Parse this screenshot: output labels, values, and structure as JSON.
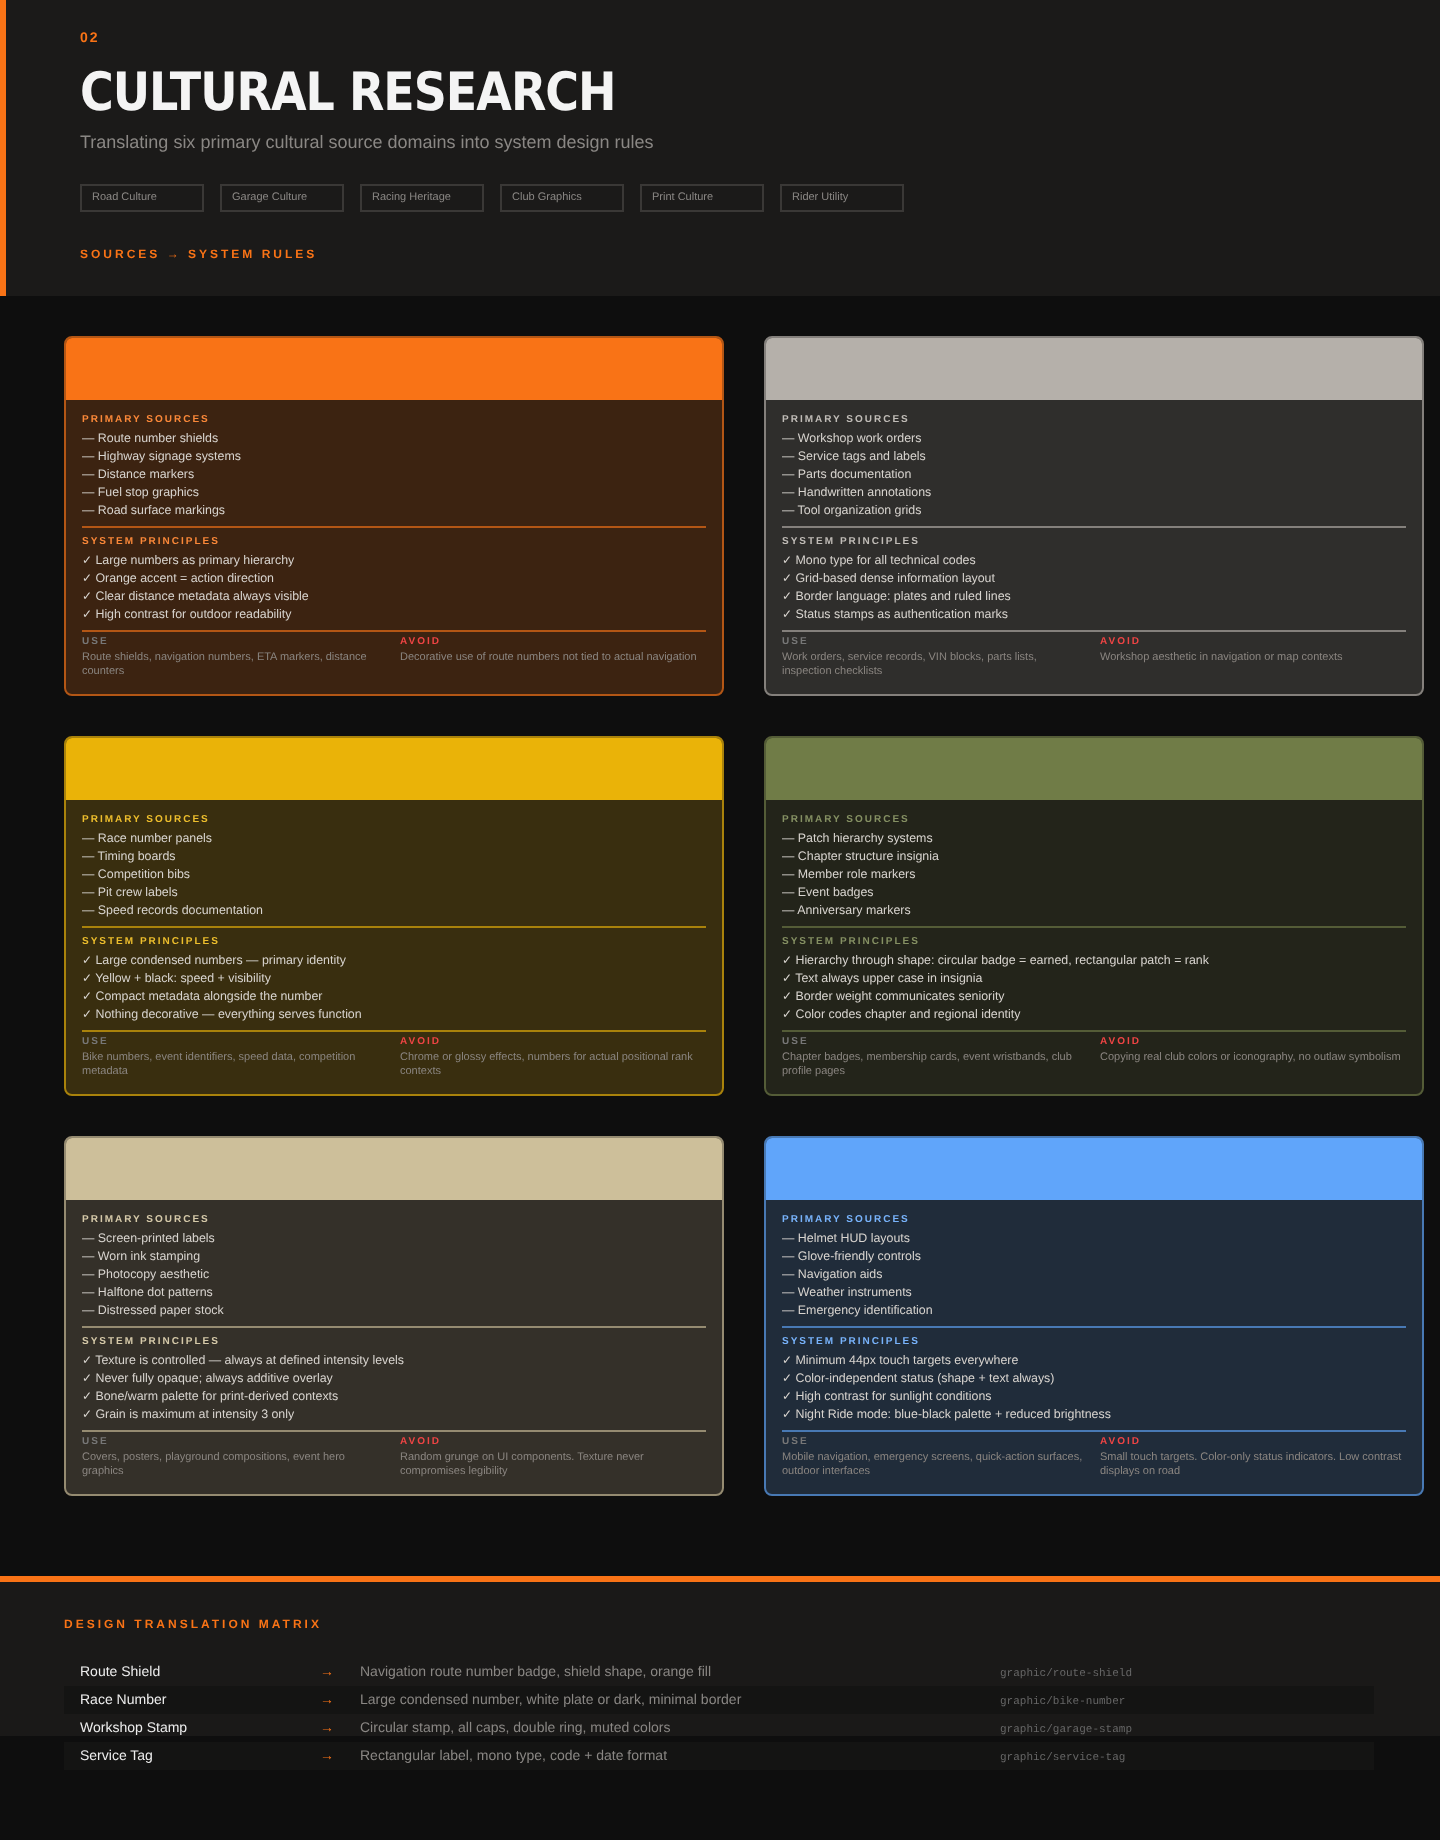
{
  "header": {
    "section_number": "02",
    "title": "CULTURAL RESEARCH",
    "subtitle": "Translating six primary cultural source domains into system design rules",
    "domains": [
      "Road Culture",
      "Garage Culture",
      "Racing Heritage",
      "Club Graphics",
      "Print Culture",
      "Rider Utility"
    ],
    "section_label": "SOURCES → SYSTEM RULES"
  },
  "cards": [
    {
      "color": "#f97316",
      "sources_label": "PRIMARY SOURCES",
      "sources": [
        "— Route number shields",
        "— Highway signage systems",
        "— Distance markers",
        "— Fuel stop graphics",
        "— Road surface markings"
      ],
      "principles_label": "SYSTEM PRINCIPLES",
      "principles": [
        "✓ Large numbers as primary hierarchy",
        "✓ Orange accent = action direction",
        "✓ Clear distance metadata always visible",
        "✓ High contrast for outdoor readability"
      ],
      "use_label": "USE",
      "use": "Route shields, navigation numbers, ETA markers, distance counters",
      "avoid_label": "AVOID",
      "avoid": "Decorative use of route numbers not tied to actual navigation"
    },
    {
      "color": "#b5b0aa",
      "sources_label": "PRIMARY SOURCES",
      "sources": [
        "— Workshop work orders",
        "— Service tags and labels",
        "— Parts documentation",
        "— Handwritten annotations",
        "— Tool organization grids"
      ],
      "principles_label": "SYSTEM PRINCIPLES",
      "principles": [
        "✓ Mono type for all technical codes",
        "✓ Grid-based dense information layout",
        "✓ Border language: plates and ruled lines",
        "✓ Status stamps as authentication marks"
      ],
      "use_label": "USE",
      "use": "Work orders, service records, VIN blocks, parts lists, inspection checklists",
      "avoid_label": "AVOID",
      "avoid": "Workshop aesthetic in navigation or map contexts"
    },
    {
      "color": "#eab308",
      "sources_label": "PRIMARY SOURCES",
      "sources": [
        "— Race number panels",
        "— Timing boards",
        "— Competition bibs",
        "— Pit crew labels",
        "— Speed records documentation"
      ],
      "principles_label": "SYSTEM PRINCIPLES",
      "principles": [
        "✓ Large condensed numbers — primary identity",
        "✓ Yellow + black: speed + visibility",
        "✓ Compact metadata alongside the number",
        "✓ Nothing decorative — everything serves function"
      ],
      "use_label": "USE",
      "use": "Bike numbers, event identifiers, speed data, competition metadata",
      "avoid_label": "AVOID",
      "avoid": "Chrome or glossy effects, numbers for actual positional rank contexts"
    },
    {
      "color": "#707c47",
      "sources_label": "PRIMARY SOURCES",
      "sources": [
        "— Patch hierarchy systems",
        "— Chapter structure insignia",
        "— Member role markers",
        "— Event badges",
        "— Anniversary markers"
      ],
      "principles_label": "SYSTEM PRINCIPLES",
      "principles": [
        "✓ Hierarchy through shape: circular badge = earned, rectangular patch = rank",
        "✓ Text always upper case in insignia",
        "✓ Border weight communicates seniority",
        "✓ Color codes chapter and regional identity"
      ],
      "use_label": "USE",
      "use": "Chapter badges, membership cards, event wristbands, club profile pages",
      "avoid_label": "AVOID",
      "avoid": "Copying real club colors or iconography, no outlaw symbolism"
    },
    {
      "color": "#cdbf9a",
      "sources_label": "PRIMARY SOURCES",
      "sources": [
        "— Screen-printed labels",
        "— Worn ink stamping",
        "— Photocopy aesthetic",
        "— Halftone dot patterns",
        "— Distressed paper stock"
      ],
      "principles_label": "SYSTEM PRINCIPLES",
      "principles": [
        "✓ Texture is controlled — always at defined intensity levels",
        "✓ Never fully opaque; always additive overlay",
        "✓ Bone/warm palette for print-derived contexts",
        "✓ Grain is maximum at intensity 3 only"
      ],
      "use_label": "USE",
      "use": "Covers, posters, playground compositions, event hero graphics",
      "avoid_label": "AVOID",
      "avoid": "Random grunge on UI components. Texture never compromises legibility"
    },
    {
      "color": "#60a5fa",
      "sources_label": "PRIMARY SOURCES",
      "sources": [
        "— Helmet HUD layouts",
        "— Glove-friendly controls",
        "— Navigation aids",
        "— Weather instruments",
        "— Emergency identification"
      ],
      "principles_label": "SYSTEM PRINCIPLES",
      "principles": [
        "✓ Minimum 44px touch targets everywhere",
        "✓ Color-independent status (shape + text always)",
        "✓ High contrast for sunlight conditions",
        "✓ Night Ride mode: blue-black palette + reduced brightness"
      ],
      "use_label": "USE",
      "use": "Mobile navigation, emergency screens, quick-action surfaces, outdoor interfaces",
      "avoid_label": "AVOID",
      "avoid": "Small touch targets. Color-only status indicators. Low contrast displays on road"
    }
  ],
  "matrix": {
    "title": "DESIGN TRANSLATION MATRIX",
    "rows": [
      {
        "source": "Route Shield",
        "arrow": "→",
        "translation": "Navigation route number badge, shield shape, orange fill",
        "asset": "graphic/route-shield"
      },
      {
        "source": "Race Number",
        "arrow": "→",
        "translation": "Large condensed number, white plate or dark, minimal border",
        "asset": "graphic/bike-number"
      },
      {
        "source": "Workshop Stamp",
        "arrow": "→",
        "translation": "Circular stamp, all caps, double ring, muted colors",
        "asset": "graphic/garage-stamp"
      },
      {
        "source": "Service Tag",
        "arrow": "→",
        "translation": "Rectangular label, mono type, code + date format",
        "asset": "graphic/service-tag"
      }
    ]
  }
}
